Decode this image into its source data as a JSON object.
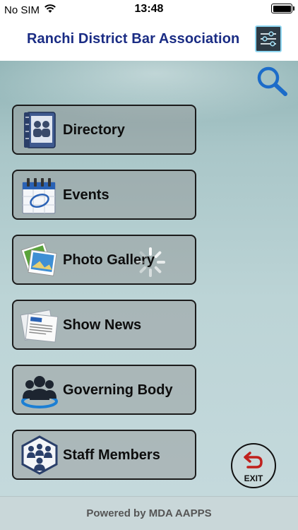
{
  "status_bar": {
    "carrier": "No SIM",
    "time": "13:48",
    "battery_level": 1.0
  },
  "header": {
    "title": "Ranchi District Bar Association",
    "settings_icon": "sliders-icon"
  },
  "search": {
    "icon": "magnifier-icon"
  },
  "menu": {
    "items": [
      {
        "label": "Directory",
        "icon": "address-book-icon"
      },
      {
        "label": "Events",
        "icon": "calendar-icon"
      },
      {
        "label": "Photo Gallery",
        "icon": "photos-icon"
      },
      {
        "label": "Show News",
        "icon": "newspaper-icon"
      },
      {
        "label": "Governing Body",
        "icon": "group-icon"
      },
      {
        "label": "Staff Members",
        "icon": "team-hexagon-icon"
      }
    ]
  },
  "exit": {
    "label": "EXIT"
  },
  "footer": {
    "text": "Powered by MDA AAPPS"
  },
  "colors": {
    "title": "#1a2c84",
    "search_icon": "#1c6cc9",
    "exit_arrow": "#c0201c"
  }
}
